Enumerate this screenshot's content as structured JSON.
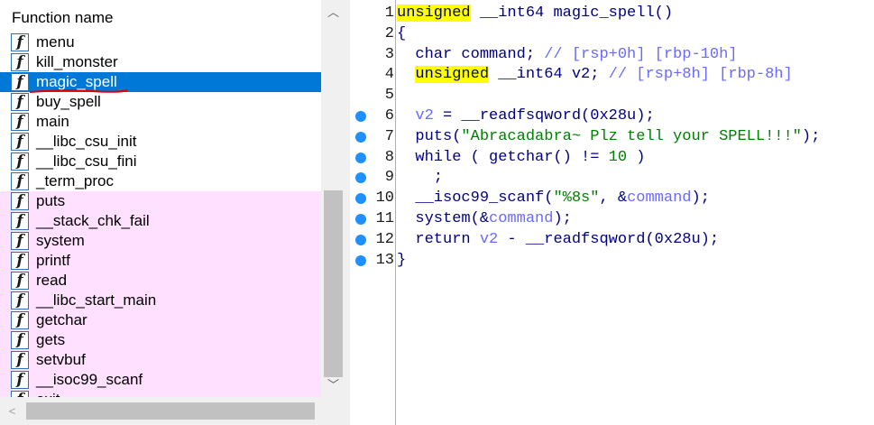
{
  "function_pane": {
    "header": "Function name",
    "functions": [
      {
        "name": "menu",
        "kind": "local"
      },
      {
        "name": "kill_monster",
        "kind": "local"
      },
      {
        "name": "magic_spell",
        "kind": "selected"
      },
      {
        "name": "buy_spell",
        "kind": "local"
      },
      {
        "name": "main",
        "kind": "local"
      },
      {
        "name": "__libc_csu_init",
        "kind": "local"
      },
      {
        "name": "__libc_csu_fini",
        "kind": "local"
      },
      {
        "name": "_term_proc",
        "kind": "local"
      },
      {
        "name": "puts",
        "kind": "import"
      },
      {
        "name": "__stack_chk_fail",
        "kind": "import"
      },
      {
        "name": "system",
        "kind": "import"
      },
      {
        "name": "printf",
        "kind": "import"
      },
      {
        "name": "read",
        "kind": "import"
      },
      {
        "name": "__libc_start_main",
        "kind": "import"
      },
      {
        "name": "getchar",
        "kind": "import"
      },
      {
        "name": "gets",
        "kind": "import"
      },
      {
        "name": "setvbuf",
        "kind": "import"
      },
      {
        "name": "__isoc99_scanf",
        "kind": "import"
      },
      {
        "name": "exit",
        "kind": "import"
      }
    ],
    "icon_glyph": "f",
    "icon_name": "function-icon",
    "colors": {
      "selected": "#0078d7",
      "import_bg": "#ffe0ff",
      "annotation": "#e00000"
    }
  },
  "code_pane": {
    "lines": [
      {
        "num": "1",
        "dot": false,
        "parts": [
          {
            "t": "unsigned",
            "c": "kw-hl"
          },
          {
            "t": " __int64 magic_spell()",
            "c": ""
          }
        ]
      },
      {
        "num": "2",
        "dot": false,
        "parts": [
          {
            "t": "{",
            "c": ""
          }
        ]
      },
      {
        "num": "3",
        "dot": false,
        "parts": [
          {
            "t": "  char command; ",
            "c": ""
          },
          {
            "t": "// [rsp+0h] [rbp-10h]",
            "c": "cmt"
          }
        ]
      },
      {
        "num": "4",
        "dot": false,
        "parts": [
          {
            "t": "  ",
            "c": ""
          },
          {
            "t": "unsigned",
            "c": "kw-hl"
          },
          {
            "t": " __int64 v2; ",
            "c": ""
          },
          {
            "t": "// [rsp+8h] [rbp-8h]",
            "c": "cmt"
          }
        ]
      },
      {
        "num": "5",
        "dot": false,
        "parts": [
          {
            "t": "",
            "c": ""
          }
        ]
      },
      {
        "num": "6",
        "dot": true,
        "parts": [
          {
            "t": "  ",
            "c": ""
          },
          {
            "t": "v2",
            "c": "var"
          },
          {
            "t": " = __readfsqword(0x28u);",
            "c": ""
          }
        ]
      },
      {
        "num": "7",
        "dot": true,
        "parts": [
          {
            "t": "  puts(",
            "c": ""
          },
          {
            "t": "\"Abracadabra~ Plz tell your SPELL!!!\"",
            "c": "str"
          },
          {
            "t": ");",
            "c": ""
          }
        ]
      },
      {
        "num": "8",
        "dot": true,
        "parts": [
          {
            "t": "  while ( getchar() != ",
            "c": ""
          },
          {
            "t": "10",
            "c": "num"
          },
          {
            "t": " )",
            "c": ""
          }
        ]
      },
      {
        "num": "9",
        "dot": true,
        "parts": [
          {
            "t": "    ;",
            "c": ""
          }
        ]
      },
      {
        "num": "10",
        "dot": true,
        "parts": [
          {
            "t": "  __isoc99_scanf(",
            "c": ""
          },
          {
            "t": "\"%8s\"",
            "c": "str"
          },
          {
            "t": ", &",
            "c": ""
          },
          {
            "t": "command",
            "c": "var"
          },
          {
            "t": ");",
            "c": ""
          }
        ]
      },
      {
        "num": "11",
        "dot": true,
        "parts": [
          {
            "t": "  system(&",
            "c": ""
          },
          {
            "t": "command",
            "c": "var"
          },
          {
            "t": ");",
            "c": ""
          }
        ]
      },
      {
        "num": "12",
        "dot": true,
        "parts": [
          {
            "t": "  return ",
            "c": ""
          },
          {
            "t": "v2",
            "c": "var"
          },
          {
            "t": " - __readfsqword(0x28u);",
            "c": ""
          }
        ]
      },
      {
        "num": "13",
        "dot": true,
        "parts": [
          {
            "t": "}",
            "c": ""
          }
        ]
      }
    ],
    "colors": {
      "dot": "#1e90ff",
      "highlight": "#ffff00",
      "string": "#007f00",
      "variable": "#6a6aff"
    }
  },
  "scrollbar": {
    "up_glyph": "︿",
    "down_glyph": "﹀",
    "left_glyph": "<"
  }
}
